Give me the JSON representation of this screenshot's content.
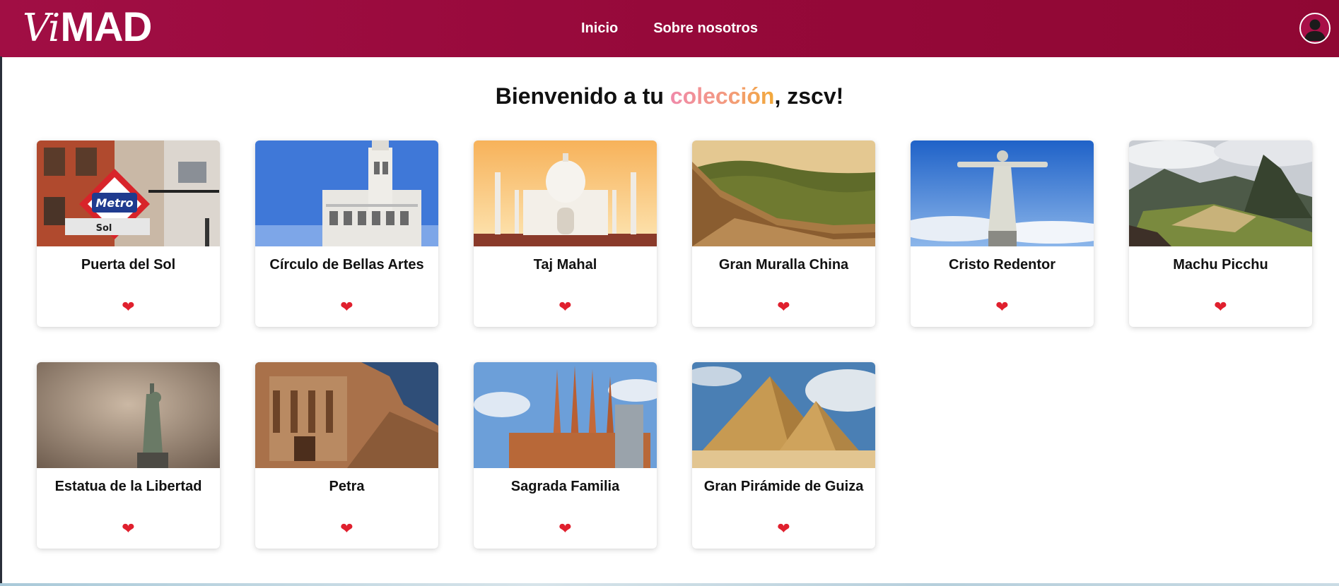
{
  "brand": {
    "logo_prefix": "Vi",
    "logo_suffix": "MAD"
  },
  "nav": {
    "links": [
      "Inicio",
      "Sobre nosotros"
    ],
    "avatar_icon": "user-avatar-icon"
  },
  "heading": {
    "prefix": "Bienvenido a tu ",
    "accent": "colección",
    "suffix": ", zscv!"
  },
  "colors": {
    "navbar": "#960a3c",
    "accent_gradient": [
      "#f08aaa",
      "#f2a93a"
    ],
    "heart": "#e0202e"
  },
  "cards": [
    {
      "title": "Puerta del Sol",
      "image": "metro-sol-photo",
      "heart": "❤"
    },
    {
      "title": "Círculo de Bellas Artes",
      "image": "bellas-artes-photo",
      "heart": "❤"
    },
    {
      "title": "Taj Mahal",
      "image": "taj-mahal-photo",
      "heart": "❤"
    },
    {
      "title": "Gran Muralla China",
      "image": "great-wall-photo",
      "heart": "❤"
    },
    {
      "title": "Cristo Redentor",
      "image": "cristo-redentor-photo",
      "heart": "❤"
    },
    {
      "title": "Machu Picchu",
      "image": "machu-picchu-photo",
      "heart": "❤"
    },
    {
      "title": "Estatua de la Libertad",
      "image": "statue-liberty-photo",
      "heart": "❤"
    },
    {
      "title": "Petra",
      "image": "petra-photo",
      "heart": "❤"
    },
    {
      "title": "Sagrada Familia",
      "image": "sagrada-familia-photo",
      "heart": "❤"
    },
    {
      "title": "Gran Pirámide de Guiza",
      "image": "pyramid-giza-photo",
      "heart": "❤"
    }
  ]
}
